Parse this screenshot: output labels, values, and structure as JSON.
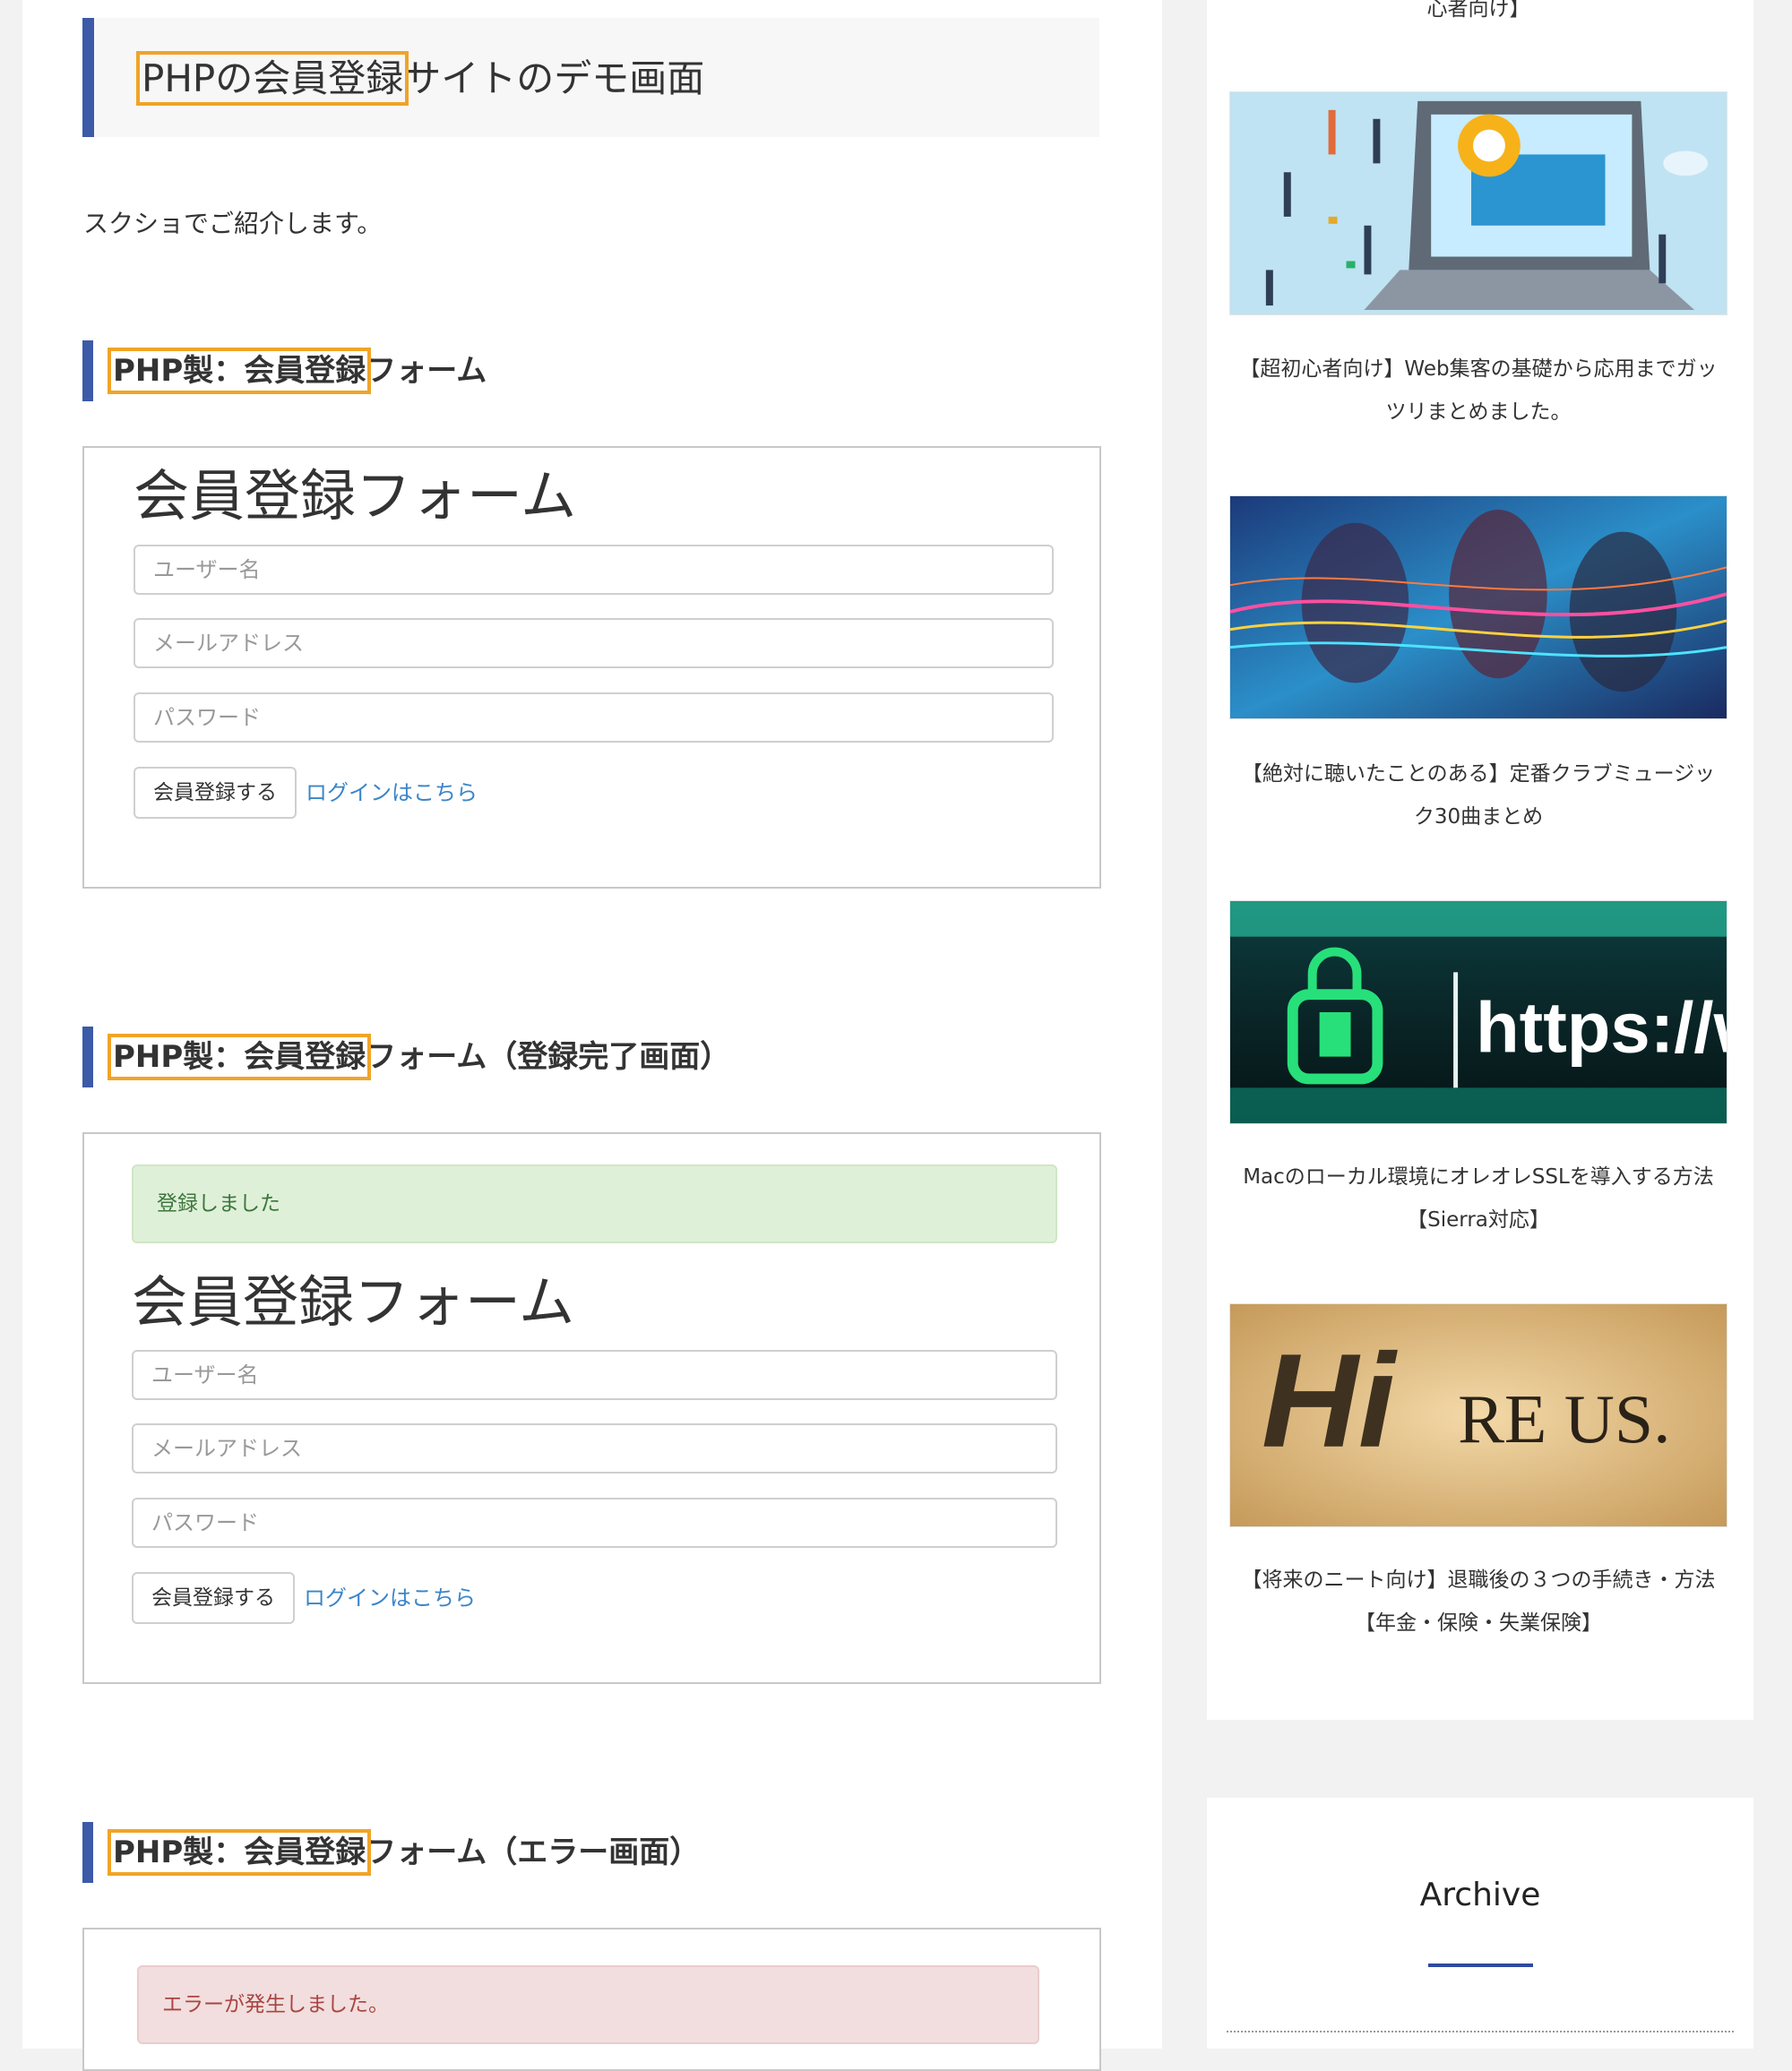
{
  "article": {
    "title_highlight": "PHPの会員登録",
    "title_rest": "サイトのデモ画面",
    "intro": "スクショでご紹介します。",
    "sections": [
      {
        "highlight": "PHP製：会員登録",
        "rest": "フォーム"
      },
      {
        "highlight": "PHP製：会員登録",
        "rest": "フォーム（登録完了画面）"
      },
      {
        "highlight": "PHP製：会員登録",
        "rest": "フォーム（エラー画面）"
      }
    ]
  },
  "demo_form": {
    "title": "会員登録フォーム",
    "username_placeholder": "ユーザー名",
    "email_placeholder": "メールアドレス",
    "password_placeholder": "パスワード",
    "submit_label": "会員登録する",
    "login_link": "ログインはこちら",
    "success_message": "登録しました",
    "error_message": "エラーが発生しました。"
  },
  "sidebar": {
    "cut_title_tail": "心者向け】",
    "posts": [
      {
        "title_line1": "【超初心者向け】Web集客の基礎から応用までガッ",
        "title_line2": "ツリまとめました。",
        "thumb": "marketing-laptop-illustration"
      },
      {
        "title_line1": "【絶対に聴いたことのある】定番クラブミュージッ",
        "title_line2": "ク30曲まとめ",
        "thumb": "club-dance-photo"
      },
      {
        "title_line1": "Macのローカル環境にオレオレSSLを導入する方法",
        "title_line2": "【Sierra対応】",
        "thumb": "https-lock-photo",
        "thumb_text": "https://w"
      },
      {
        "title_line1": "【将来のニート向け】退職後の３つの手続き・方法",
        "title_line2": "【年金・保険・失業保険】",
        "thumb": "hire-us-photo",
        "thumb_text_bold": "Hi",
        "thumb_text_hand": "RE US."
      }
    ],
    "archive_title": "Archive"
  },
  "colors": {
    "accent_blue": "#3c5aa8",
    "highlight_orange": "#f0a428",
    "link_blue": "#3a85c8",
    "success_bg": "#dff0d8",
    "error_bg": "#f2dede"
  }
}
